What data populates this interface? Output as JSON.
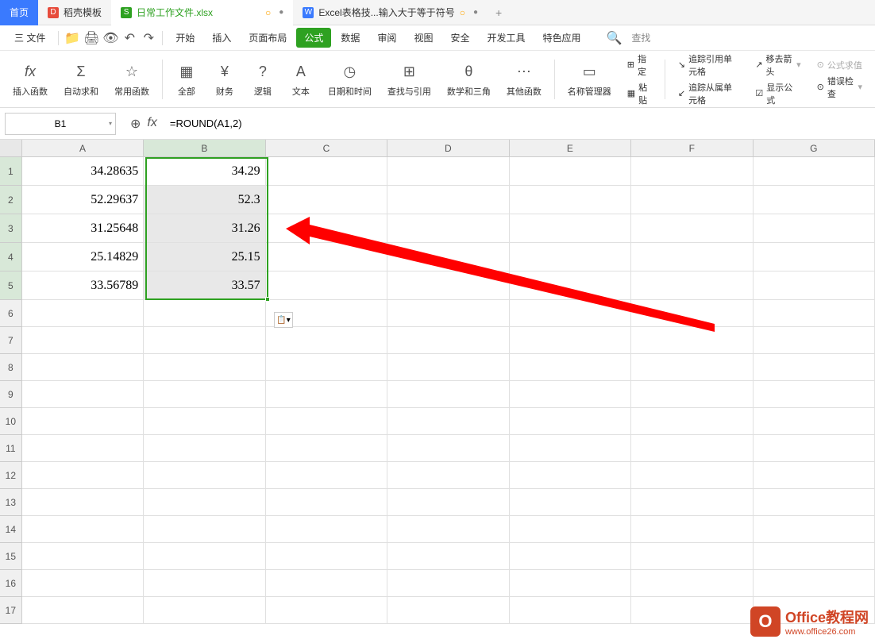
{
  "tabs": [
    {
      "label": "首页",
      "active": true
    },
    {
      "label": "稻壳模板",
      "icon_color": "#e74c3c"
    },
    {
      "label": "日常工作文件.xlsx",
      "icon_color": "#2ea121",
      "modified": true
    },
    {
      "label": "Excel表格技...输入大于等于符号",
      "icon_color": "#3a7afe",
      "modified": true
    }
  ],
  "menu": {
    "file": "三 文件",
    "items": [
      "开始",
      "插入",
      "页面布局",
      "公式",
      "数据",
      "审阅",
      "视图",
      "安全",
      "开发工具",
      "特色应用"
    ],
    "active": "公式",
    "search": "查找"
  },
  "ribbon": {
    "groups": [
      {
        "icon": "fx",
        "label": "插入函数"
      },
      {
        "icon": "Σ",
        "label": "自动求和"
      },
      {
        "icon": "☆",
        "label": "常用函数"
      },
      {
        "icon": "▦",
        "label": "全部"
      },
      {
        "icon": "¥",
        "label": "财务"
      },
      {
        "icon": "?",
        "label": "逻辑"
      },
      {
        "icon": "A",
        "label": "文本"
      },
      {
        "icon": "◷",
        "label": "日期和时间"
      },
      {
        "icon": "⊞",
        "label": "查找与引用"
      },
      {
        "icon": "θ",
        "label": "数学和三角"
      },
      {
        "icon": "⋯",
        "label": "其他函数"
      },
      {
        "icon": "▭",
        "label": "名称管理器"
      }
    ],
    "right_items": [
      {
        "icon": "⊞",
        "label": "指定"
      },
      {
        "icon": "▦",
        "label": "粘贴"
      },
      {
        "icon": "↘",
        "label": "追踪引用单元格"
      },
      {
        "icon": "↗",
        "label": "移去箭头"
      },
      {
        "icon": "fx",
        "label": "公式求值"
      },
      {
        "icon": "↙",
        "label": "追踪从属单元格"
      },
      {
        "icon": "☑",
        "label": "显示公式"
      },
      {
        "icon": "⊙",
        "label": "错误检查"
      }
    ]
  },
  "formula_bar": {
    "name_box": "B1",
    "formula": "=ROUND(A1,2)"
  },
  "columns": [
    "A",
    "B",
    "C",
    "D",
    "E",
    "F",
    "G"
  ],
  "rows": [
    1,
    2,
    3,
    4,
    5,
    6,
    7,
    8,
    9,
    10,
    11,
    12,
    13,
    14,
    15,
    16,
    17
  ],
  "data": {
    "A": [
      "34.28635",
      "52.29637",
      "31.25648",
      "25.14829",
      "33.56789"
    ],
    "B": [
      "34.29",
      "52.3",
      "31.26",
      "25.15",
      "33.57"
    ]
  },
  "watermark": {
    "title": "Office教程网",
    "url": "www.office26.com",
    "icon_text": "O"
  }
}
